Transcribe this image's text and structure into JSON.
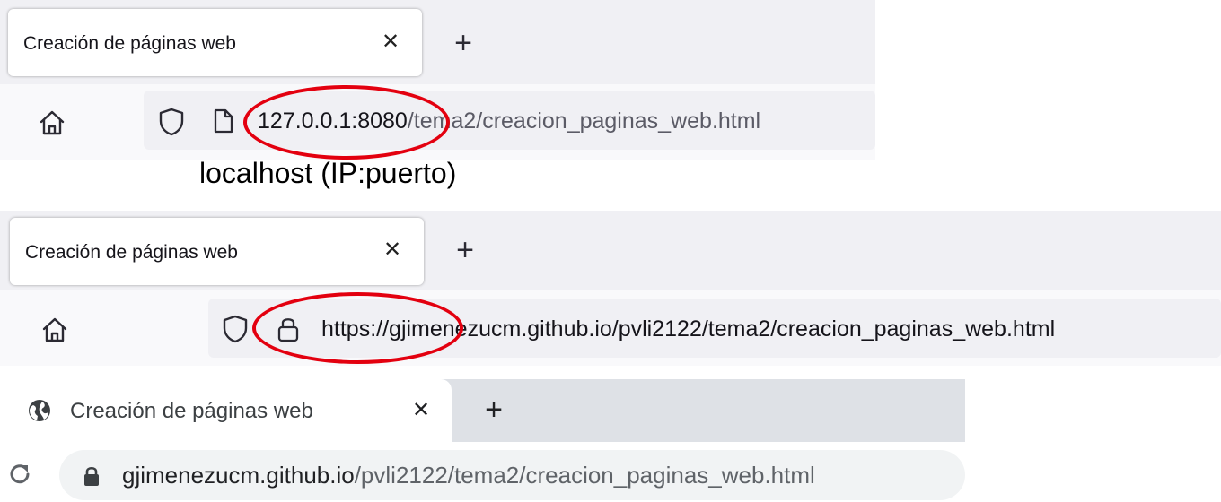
{
  "firefox_local": {
    "tab_title": "Creación de páginas web",
    "tab_close": "✕",
    "new_tab": "+",
    "url_host": "127.0.0.1:8080",
    "url_path": "/tema2/creacion_paginas_web.html"
  },
  "caption": "localhost (IP:puerto)",
  "firefox_github": {
    "tab_title": "Creación de páginas web",
    "tab_close": "✕",
    "new_tab": "+",
    "url": "https://gjimenezucm.github.io/pvli2122/tema2/creacion_paginas_web.html"
  },
  "chrome_github": {
    "tab_title": "Creación de páginas web",
    "tab_close": "✕",
    "new_tab": "+",
    "url_host": "gjimenezucm.github.io",
    "url_path": "/pvli2122/tema2/creacion_paginas_web.html"
  },
  "colors": {
    "annotation_red": "#e3000f",
    "toolbar_bg": "#f0f0f4",
    "chrome_tabstrip": "#dee1e6"
  },
  "icons": {
    "home": "home-icon",
    "shield": "shield-icon",
    "page": "page-icon",
    "lock": "lock-icon",
    "globe": "globe-icon",
    "reload": "reload-icon"
  }
}
